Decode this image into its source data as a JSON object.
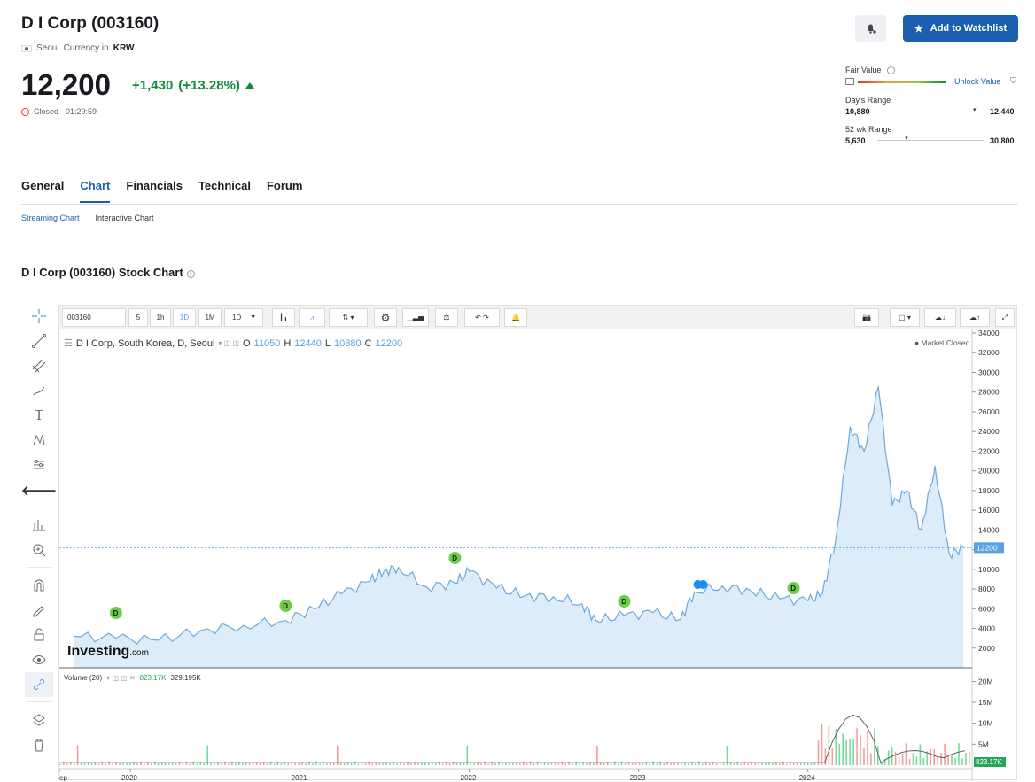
{
  "header": {
    "title": "D I Corp (003160)",
    "exchange": "Seoul",
    "currency_label": "Currency in",
    "currency": "KRW",
    "price": "12,200",
    "change": "+1,430",
    "change_pct": "(+13.28%)",
    "status": "Closed · 01:29:59",
    "watchlist_label": "Add to Watchlist"
  },
  "ranges": {
    "fair_value_label": "Fair Value",
    "unlock_label": "Unlock Value",
    "day_label": "Day's Range",
    "day_low": "10,880",
    "day_high": "12,440",
    "day_marker": 0.9,
    "wk_label": "52 wk Range",
    "wk_low": "5,630",
    "wk_high": "30,800",
    "wk_marker": 0.26
  },
  "tabs": [
    "General",
    "Chart",
    "Financials",
    "Technical",
    "Forum"
  ],
  "subtabs": [
    "Streaming Chart",
    "Interactive Chart"
  ],
  "chart_title": "D I Corp (003160) Stock Chart",
  "toolbar": {
    "symbol": "003160",
    "intervals": [
      "5",
      "1h",
      "1D",
      "1M",
      "1D"
    ]
  },
  "legend": {
    "name": "D I Corp, South Korea, D, Seoul",
    "o_label": "O",
    "o": "11050",
    "h_label": "H",
    "h": "12440",
    "l_label": "L",
    "l": "10880",
    "c_label": "C",
    "c": "12200",
    "market_closed": "Market Closed"
  },
  "volume_legend": {
    "label": "Volume (20)",
    "v1": "823.17K",
    "v2": "329.195K",
    "last": "823.17K"
  },
  "watermark": {
    "brand": "Investing",
    "suffix": ".com"
  },
  "colors": {
    "accent": "#1c5fb1",
    "up": "#0f8a3a",
    "line": "#6fa8dc",
    "area": "#dcecf8"
  },
  "chart_data": {
    "type": "area",
    "price_axis": [
      "34000",
      "32000",
      "30000",
      "28000",
      "26000",
      "24000",
      "22000",
      "20000",
      "18000",
      "16000",
      "14000",
      "12000",
      "10000",
      "8000",
      "6000",
      "4000",
      "2000"
    ],
    "ylim": [
      0,
      34000
    ],
    "last_price_tag": "12200",
    "x_ticks": [
      "ep",
      "2020",
      "2021",
      "2022",
      "2023",
      "2024"
    ],
    "x": [
      "2019-09",
      "2019-12",
      "2020-03",
      "2020-06",
      "2020-09",
      "2020-12",
      "2021-02",
      "2021-04",
      "2021-06",
      "2021-07",
      "2021-08",
      "2021-10",
      "2021-12",
      "2022-01",
      "2022-03",
      "2022-05",
      "2022-07",
      "2022-09",
      "2022-10",
      "2022-12",
      "2023-02",
      "2023-04",
      "2023-05",
      "2023-07",
      "2023-09",
      "2023-11",
      "2024-01",
      "2024-02",
      "2024-03",
      "2024-04",
      "2024-05",
      "2024-06",
      "2024-07",
      "2024-08",
      "2024-09",
      "2024-10",
      "2024-11",
      "2024-12"
    ],
    "series": [
      {
        "values": [
          3200,
          3000,
          2800,
          3800,
          4300,
          4800,
          6000,
          7500,
          8800,
          9800,
          10200,
          8200,
          8600,
          9800,
          8100,
          7300,
          7200,
          6500,
          4800,
          5300,
          5600,
          4900,
          7700,
          8300,
          7800,
          7000,
          6800,
          7500,
          13000,
          24500,
          22000,
          28500,
          16500,
          18000,
          14000,
          20500,
          11500,
          12200
        ]
      }
    ],
    "volume_axis": [
      "20M",
      "15M",
      "10M",
      "5M"
    ],
    "dividend_markers": [
      "D",
      "D",
      "D",
      "D",
      "D"
    ]
  }
}
